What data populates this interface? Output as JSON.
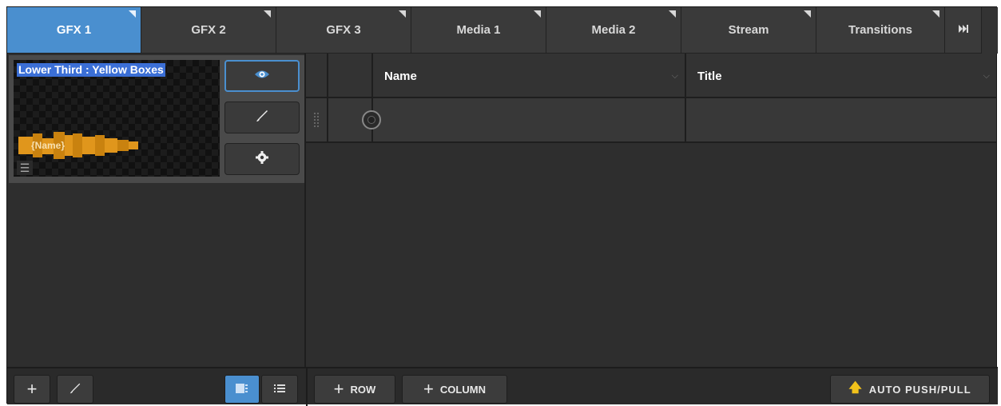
{
  "tabs": [
    {
      "label": "GFX 1",
      "active": true
    },
    {
      "label": "GFX 2",
      "active": false
    },
    {
      "label": "GFX 3",
      "active": false
    },
    {
      "label": "Media 1",
      "active": false
    },
    {
      "label": "Media 2",
      "active": false
    },
    {
      "label": "Stream",
      "active": false
    },
    {
      "label": "Transitions",
      "active": false
    }
  ],
  "tab_end_icon": "skip-to-end-icon",
  "graphic": {
    "title": "Lower Third : Yellow Boxes",
    "name_text": "{Name}",
    "buttons": [
      "eye-icon",
      "brush-icon",
      "gear-icon"
    ]
  },
  "table": {
    "columns": [
      {
        "label": "Name"
      },
      {
        "label": "Title"
      }
    ],
    "rows": [
      {
        "name": "",
        "title": ""
      }
    ]
  },
  "bottom": {
    "add_icon": "plus-icon",
    "edit_icon": "brush-icon",
    "view_icons": [
      "grid-view-icon",
      "list-view-icon"
    ],
    "add_row_label": "ROW",
    "add_column_label": "COLUMN",
    "auto_push_label": "AUTO PUSH/PULL"
  },
  "colors": {
    "accent": "#4a8fcf",
    "highlight": "#3b6fd6",
    "bar": "#e0961c",
    "arrow": "#f2c21b"
  }
}
